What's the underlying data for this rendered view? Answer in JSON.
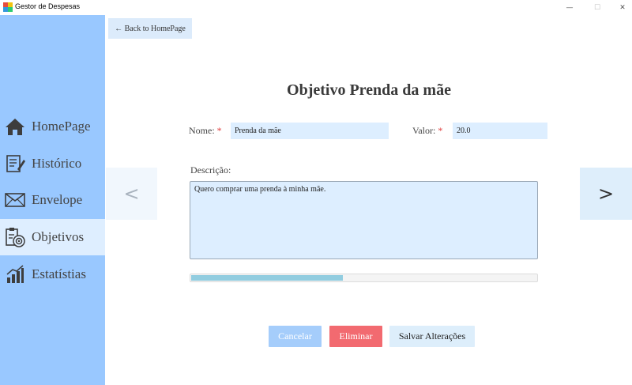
{
  "window": {
    "title": "Gestor de Despesas",
    "minimize": "—",
    "maximize": "☐",
    "close": "✕"
  },
  "sidebar": {
    "items": [
      {
        "label": "HomePage",
        "icon": "home-icon"
      },
      {
        "label": "Histórico",
        "icon": "history-icon"
      },
      {
        "label": "Envelope",
        "icon": "envelope-icon"
      },
      {
        "label": "Objetivos",
        "icon": "goals-icon",
        "active": true
      },
      {
        "label": "Estatístias",
        "icon": "chart-icon"
      }
    ],
    "colors": {
      "background": "#99c8ff",
      "active": "#deeeff"
    }
  },
  "back_button": {
    "label": "← Back to HomePage"
  },
  "nav_arrows": {
    "prev": "<",
    "next": ">"
  },
  "page": {
    "title": "Objetivo Prenda da mãe"
  },
  "form": {
    "name_label": "Nome:",
    "name_value": "Prenda da mãe",
    "value_label": "Valor:",
    "value_value": "20.0",
    "required_mark": "*",
    "description_label": "Descrição:",
    "description_value": "Quero comprar uma prenda à minha mãe."
  },
  "progress": {
    "fraction": 0.44,
    "color": "#92cde0"
  },
  "buttons": {
    "cancel": "Cancelar",
    "delete": "Eliminar",
    "save": "Salvar Alterações"
  }
}
